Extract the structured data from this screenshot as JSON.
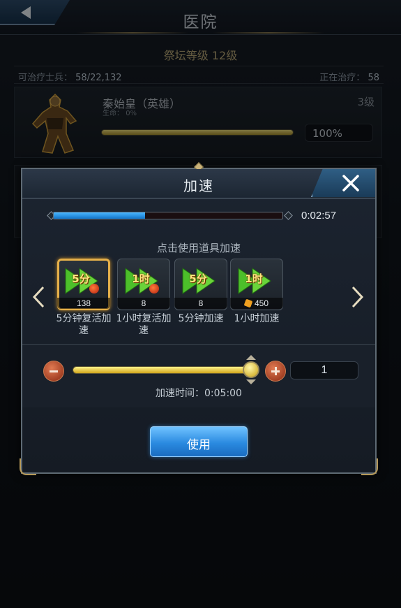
{
  "screen": {
    "title": "医院",
    "altar_level": "祭坛等级  12级",
    "healable_label": "可治疗士兵：",
    "healable_value": "58/22,132",
    "healing_label": "正在治疗：",
    "healing_value": "58"
  },
  "hero": {
    "name": "秦始皇（英雄）",
    "level": "3级",
    "hp_label": "生命：",
    "hp_small": "0%",
    "hp_percent_text": "100%",
    "hp_fraction": 1.0
  },
  "dialog": {
    "title": "加速",
    "timer_text": "0:02:57",
    "timer_fraction": 0.4,
    "hint": "点击使用道具加速",
    "items": [
      {
        "icon_label": "5分",
        "count": "138",
        "name": "5分钟复活加速",
        "selected": true,
        "currency": "medal"
      },
      {
        "icon_label": "1时",
        "count": "8",
        "name": "1小时复活加速",
        "selected": false,
        "currency": "medal"
      },
      {
        "icon_label": "5分",
        "count": "8",
        "name": "5分钟加速",
        "selected": false,
        "currency": "none"
      },
      {
        "icon_label": "1时",
        "count": "450",
        "name": "1小时加速",
        "selected": false,
        "currency": "gem"
      }
    ],
    "slider_fraction": 1.0,
    "quantity": "1",
    "speed_time": "加速时间：0:05:00",
    "use_button": "使用"
  },
  "colors": {
    "accent_gold": "#e5b04a",
    "timer_blue": "#2a8ae0",
    "hp_yellow": "#d0a61c"
  }
}
